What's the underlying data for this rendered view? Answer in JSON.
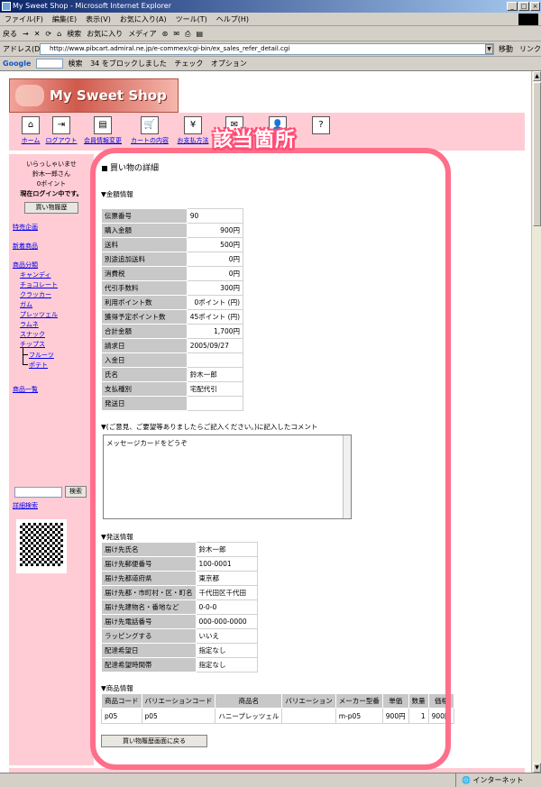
{
  "window": {
    "title": "My Sweet Shop - Microsoft Internet Explorer"
  },
  "menu": [
    "ファイル(F)",
    "編集(E)",
    "表示(V)",
    "お気に入り(A)",
    "ツール(T)",
    "ヘルプ(H)"
  ],
  "toolbar": [
    "戻る",
    "→",
    "✕",
    "⟳",
    "⌂",
    "検索",
    "お気に入り",
    "メディア",
    "⊛",
    "✉",
    "⎙",
    "▤"
  ],
  "address": {
    "label": "アドレス(D)",
    "url": "http://www.pibcart.admiral.ne.jp/e-commex/cgi-bin/ex_sales_refer_detail.cgi",
    "go": "移動",
    "links": "リンク"
  },
  "google": {
    "logo": "Google",
    "search": "検索",
    "blocked": "34 をブロックしました",
    "check": "チェック",
    "options": "オプション"
  },
  "status": {
    "left": "",
    "zone": "インターネット"
  },
  "shop": {
    "name": "My Sweet Shop"
  },
  "nav": [
    {
      "label": "ホーム",
      "icon": "⌂"
    },
    {
      "label": "ログアウト",
      "icon": "⇥"
    },
    {
      "label": "会員情報変更",
      "icon": "▤"
    },
    {
      "label": "カートの内容",
      "icon": "🛒"
    },
    {
      "label": "お支払方法",
      "icon": "¥"
    },
    {
      "label": "",
      "icon": "✉"
    },
    {
      "label": "",
      "icon": "👤"
    },
    {
      "label": "",
      "icon": "?"
    }
  ],
  "sidebar": {
    "welcome": "いらっしゃいませ",
    "user": "鈴木一郎さん",
    "points": "0ポイント",
    "login_status": "現在ログイン中です。",
    "history_button": "買い物履歴",
    "special": "特売企画",
    "new_items": "新着商品",
    "categories_heading": "商品分類",
    "categories": [
      "キャンディ",
      "チョコレート",
      "クラッカー",
      "ガム",
      "プレッツェル",
      "ラムネ",
      "スナック",
      "チップス"
    ],
    "subcategories": [
      "フルーツ",
      "ポテト"
    ],
    "item_list": "商品一覧",
    "search_button": "検索",
    "advanced_search": "詳細検索"
  },
  "main": {
    "title": "買い物の詳細",
    "money_heading": "▼金額情報",
    "money": [
      {
        "k": "伝票番号",
        "v": "90"
      },
      {
        "k": "購入金額",
        "v": "900円"
      },
      {
        "k": "送料",
        "v": "500円"
      },
      {
        "k": "別途追加送料",
        "v": "0円"
      },
      {
        "k": "消費税",
        "v": "0円"
      },
      {
        "k": "代引手数料",
        "v": "300円"
      },
      {
        "k": "利用ポイント数",
        "v": "0ポイント (円)"
      },
      {
        "k": "獲得予定ポイント数",
        "v": "45ポイント (円)"
      },
      {
        "k": "合計金額",
        "v": "1,700円"
      },
      {
        "k": "請求日",
        "v": "2005/09/27"
      },
      {
        "k": "入金日",
        "v": ""
      },
      {
        "k": "氏名",
        "v": "鈴木一郎"
      },
      {
        "k": "支払種別",
        "v": "宅配代引"
      },
      {
        "k": "発送日",
        "v": ""
      }
    ],
    "comment_heading": "▼(ご意見、ご要望等ありましたらご記入ください。)に記入したコメント",
    "comment_text": "メッセージカードをどうぞ",
    "ship_heading": "▼発送情報",
    "ship": [
      {
        "k": "届け先氏名",
        "v": "鈴木一郎"
      },
      {
        "k": "届け先郵便番号",
        "v": "100-0001"
      },
      {
        "k": "届け先都道府県",
        "v": "東京都"
      },
      {
        "k": "届け先都・市町村・区・町名",
        "v": "千代田区千代田"
      },
      {
        "k": "届け先建物名・番地など",
        "v": "0-0-0"
      },
      {
        "k": "届け先電話番号",
        "v": "000-000-0000"
      },
      {
        "k": "ラッピングする",
        "v": "いいえ"
      },
      {
        "k": "配達希望日",
        "v": "指定なし"
      },
      {
        "k": "配達希望時間帯",
        "v": "指定なし"
      }
    ],
    "item_heading": "▼商品情報",
    "item_headers": [
      "商品コード",
      "バリエーションコード",
      "商品名",
      "バリエーション",
      "メーカー型番",
      "単価",
      "数量",
      "価格"
    ],
    "items": [
      [
        "p05",
        "p05",
        "ハニープレッツェル",
        "",
        "m-p05",
        "900円",
        "1",
        "900円"
      ]
    ],
    "back_button": "買い物履歴画面に戻る"
  },
  "annotation": {
    "label": "該当箇所",
    "color": "#ff6f8a"
  }
}
